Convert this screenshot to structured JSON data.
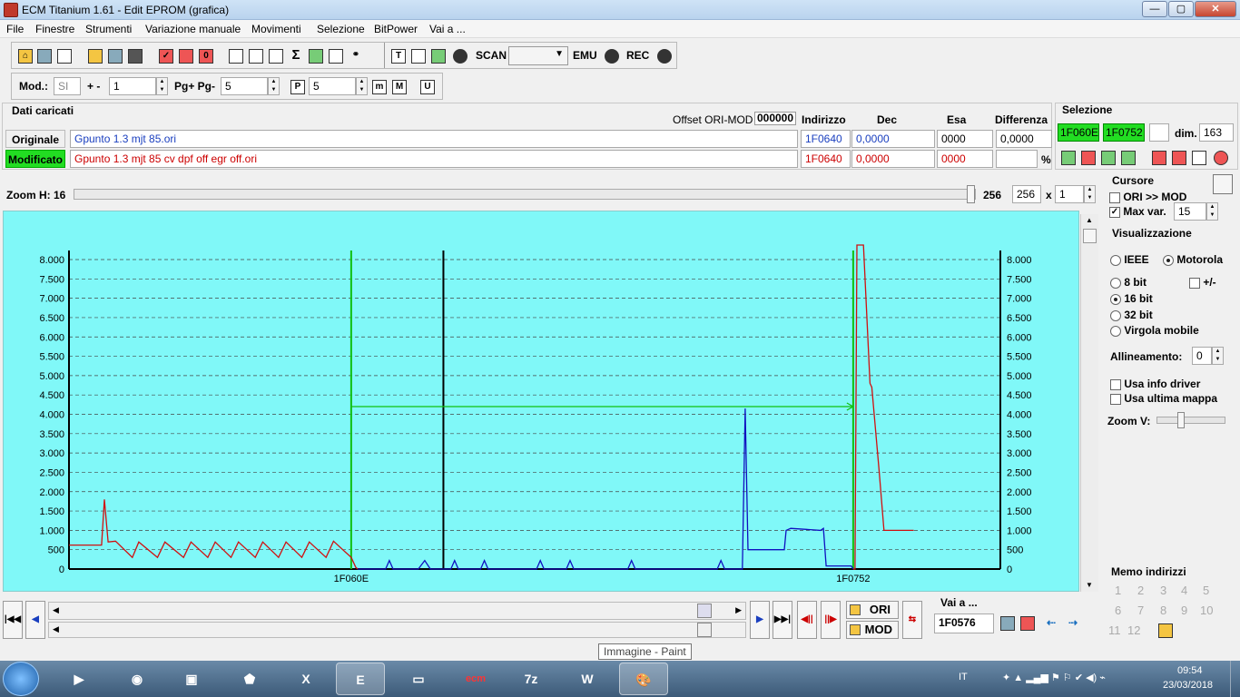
{
  "window": {
    "title": "ECM Titanium 1.61 - Edit EPROM (grafica)",
    "min": "—",
    "max": "▢",
    "close": "✕"
  },
  "menu": [
    "File",
    "Finestre",
    "Strumenti",
    "Variazione manuale",
    "Movimenti",
    "Selezione",
    "BitPower",
    "Vai a ..."
  ],
  "toolbar": {
    "scan_label": "SCAN",
    "emu_label": "EMU",
    "rec_label": "REC"
  },
  "toolbar2": {
    "mod_label": "Mod.:",
    "mod_value": "SI",
    "plusminus_label": "+ -",
    "plusminus_value": "1",
    "pg_label": "Pg+ Pg-",
    "pg_value": "5",
    "p_value": "5",
    "p_icon": "P",
    "m_icon": "m",
    "M_icon": "M",
    "u_icon": "U"
  },
  "loaded": {
    "section_title": "Dati caricati",
    "offset_label": "Offset ORI-MOD",
    "offset_value": "000000",
    "headers": {
      "indirizzo": "Indirizzo",
      "dec": "Dec",
      "esa": "Esa",
      "differenza": "Differenza"
    },
    "original": {
      "label": "Originale",
      "file": "Gpunto 1.3 mjt 85.ori",
      "indirizzo": "1F0640",
      "dec": "0,0000",
      "esa": "0000",
      "differenza": "0,0000"
    },
    "modified": {
      "label": "Modificato",
      "file": "Gpunto 1.3 mjt 85 cv dpf off egr off.ori",
      "indirizzo": "1F0640",
      "dec": "0,0000",
      "esa": "0000",
      "percent": "%"
    }
  },
  "selection": {
    "title": "Selezione",
    "start": "1F060E",
    "end": "1F0752",
    "dim_label": "dim.",
    "dim_value": "163"
  },
  "zoom": {
    "label": "Zoom H: 16",
    "val1": "256",
    "val2": "256",
    "x": "x",
    "mult": "1"
  },
  "cursor": {
    "title": "Cursore",
    "ori_mod": "ORI >> MOD",
    "max_var": "Max var.",
    "max_var_value": "15",
    "ori_mod_checked": false,
    "max_var_checked": true
  },
  "view": {
    "title": "Visualizzazione",
    "ieee": "IEEE",
    "motorola": "Motorola",
    "b8": "8 bit",
    "b16": "16 bit",
    "b32": "32 bit",
    "float": "Virgola mobile",
    "plusminus": "+/-",
    "align_label": "Allineamento:",
    "align_value": "0",
    "info_driver": "Usa info driver",
    "last_map": "Usa ultima mappa",
    "zoomv": "Zoom V:"
  },
  "memo": {
    "title": "Memo indirizzi",
    "nums": [
      "1",
      "2",
      "3",
      "4",
      "5",
      "6",
      "7",
      "8",
      "9",
      "10",
      "11",
      "12"
    ]
  },
  "bottom": {
    "ori_btn": "ORI",
    "mod_btn": "MOD",
    "vai_label": "Vai a ...",
    "vai_value": "1F0576"
  },
  "tooltip": "Immagine - Paint",
  "taskbar": {
    "lang": "IT",
    "time": "09:54",
    "date": "23/03/2018",
    "ecm_label": "ecm",
    "sevenzip": "7z",
    "word": "W"
  },
  "chart_data": {
    "type": "line",
    "ylim": [
      0,
      8000
    ],
    "yticks": [
      "0",
      "500",
      "1.000",
      "1.500",
      "2.000",
      "2.500",
      "3.000",
      "3.500",
      "4.000",
      "4.500",
      "5.000",
      "5.500",
      "6.000",
      "6.500",
      "7.000",
      "7.500",
      "8.000"
    ],
    "xlabels": [
      "1F060E",
      "1F0752"
    ],
    "grid": true,
    "series": [
      {
        "color": "#d01010",
        "values": [
          [
            0,
            620
          ],
          [
            3.5,
            620
          ],
          [
            3.8,
            1800
          ],
          [
            4.2,
            700
          ],
          [
            5,
            720
          ],
          [
            6.8,
            300
          ],
          [
            7.5,
            700
          ],
          [
            9.5,
            300
          ],
          [
            10.3,
            700
          ],
          [
            12.3,
            300
          ],
          [
            13.1,
            700
          ],
          [
            14.9,
            300
          ],
          [
            15.7,
            700
          ],
          [
            17.4,
            300
          ],
          [
            18.2,
            700
          ],
          [
            20,
            300
          ],
          [
            20.8,
            700
          ],
          [
            22.5,
            300
          ],
          [
            23.3,
            700
          ],
          [
            25,
            300
          ],
          [
            25.8,
            700
          ],
          [
            27.6,
            300
          ],
          [
            28.4,
            720
          ],
          [
            30.3,
            300
          ],
          [
            30.8,
            40
          ],
          [
            31,
            0
          ]
        ]
      },
      {
        "color": "#1010c0",
        "values": [
          [
            31,
            0
          ],
          [
            34,
            0
          ],
          [
            34.4,
            220
          ],
          [
            34.8,
            0
          ],
          [
            37.5,
            0
          ],
          [
            38.2,
            220
          ],
          [
            38.8,
            0
          ],
          [
            41,
            0
          ],
          [
            41.4,
            220
          ],
          [
            41.8,
            0
          ],
          [
            44.2,
            0
          ],
          [
            44.6,
            220
          ],
          [
            45,
            0
          ],
          [
            50.2,
            0
          ],
          [
            50.6,
            220
          ],
          [
            51,
            0
          ],
          [
            53.4,
            0
          ],
          [
            53.8,
            220
          ],
          [
            54.2,
            0
          ],
          [
            60,
            0
          ],
          [
            60.4,
            220
          ],
          [
            60.8,
            0
          ],
          [
            69.6,
            0
          ],
          [
            70,
            220
          ],
          [
            70.4,
            0
          ],
          [
            72.3,
            0
          ],
          [
            72.6,
            4150
          ],
          [
            72.9,
            500
          ],
          [
            76.8,
            500
          ],
          [
            77,
            1000
          ],
          [
            77.5,
            1050
          ],
          [
            80.7,
            1000
          ],
          [
            81,
            1050
          ],
          [
            81.3,
            80
          ],
          [
            84,
            80
          ],
          [
            84.2,
            0
          ]
        ]
      },
      {
        "color": "#d01010",
        "values": [
          [
            84.2,
            0
          ],
          [
            84.4,
            0
          ],
          [
            84.6,
            8400
          ],
          [
            85.3,
            8400
          ],
          [
            86,
            4800
          ],
          [
            86.2,
            4700
          ],
          [
            87,
            2500
          ],
          [
            87.5,
            1000
          ],
          [
            90.7,
            1000
          ]
        ]
      }
    ],
    "cursor_lines": [
      {
        "color": "#10c010",
        "x": 30.3
      },
      {
        "color": "#000000",
        "x": 40.2
      },
      {
        "color": "#10c010",
        "x": 84.2
      }
    ],
    "selection_arrow": {
      "y": 4200
    }
  }
}
